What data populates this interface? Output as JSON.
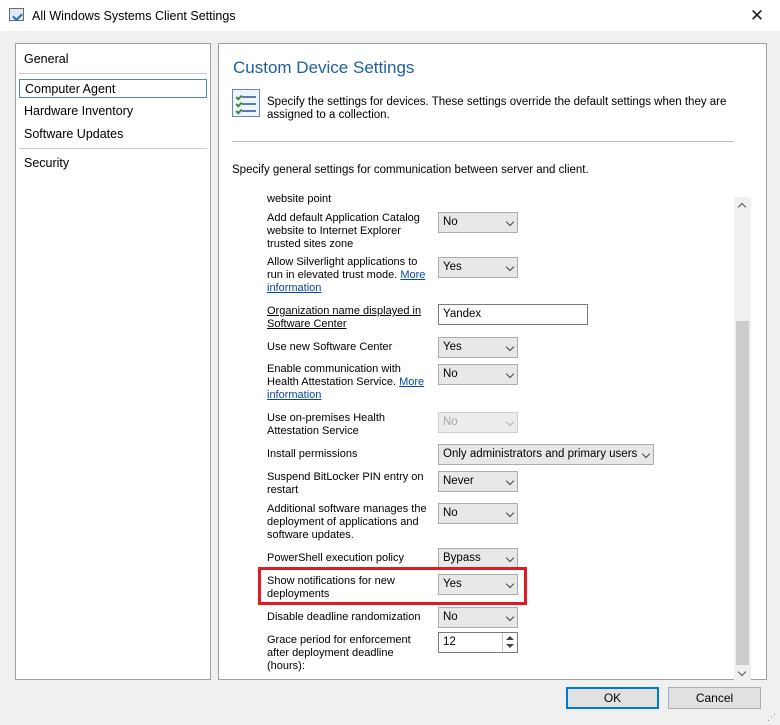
{
  "window": {
    "title": "All Windows Systems Client Settings",
    "close_glyph": "✕"
  },
  "nav": {
    "items": [
      {
        "label": "General"
      },
      {
        "label": "Computer Agent"
      },
      {
        "label": "Hardware Inventory"
      },
      {
        "label": "Software Updates"
      },
      {
        "label": "Security"
      }
    ],
    "selected": "Computer Agent"
  },
  "panel": {
    "heading": "Custom Device Settings",
    "description": "Specify the settings for devices. These settings override the default settings when they are assigned to a collection.",
    "general_text": "Specify general settings for communication between server and client."
  },
  "settings": {
    "website_point": {
      "label_tail": "website point"
    },
    "ie_trusted": {
      "label": "Add default Application Catalog website to Internet Explorer trusted sites zone",
      "value": "No"
    },
    "silverlight": {
      "label": "Allow Silverlight applications to run in elevated trust mode.",
      "link": "More information",
      "value": "Yes"
    },
    "org_name": {
      "label": "Organization name displayed in Software Center",
      "value": "Yandex"
    },
    "new_sc": {
      "label": "Use new Software Center",
      "value": "Yes"
    },
    "health_attest": {
      "label": "Enable communication with Health Attestation Service.",
      "link": "More information",
      "value": "No"
    },
    "onprem_health": {
      "label": "Use on-premises Health Attestation Service",
      "value": "No"
    },
    "install_perm": {
      "label": "Install permissions",
      "value": "Only administrators and primary users"
    },
    "bitlocker": {
      "label": "Suspend BitLocker PIN entry on restart",
      "value": "Never"
    },
    "addl_software": {
      "label": "Additional software manages the deployment of applications and software updates.",
      "value": "No"
    },
    "powershell": {
      "label": "PowerShell execution policy",
      "value": "Bypass"
    },
    "notifications": {
      "label": "Show notifications for new deployments",
      "value": "Yes"
    },
    "deadline_rand": {
      "label": "Disable deadline randomization",
      "value": "No"
    },
    "grace": {
      "label": "Grace period for enforcement after deployment deadline (hours):",
      "value": "12"
    }
  },
  "buttons": {
    "ok": "OK",
    "cancel": "Cancel"
  }
}
